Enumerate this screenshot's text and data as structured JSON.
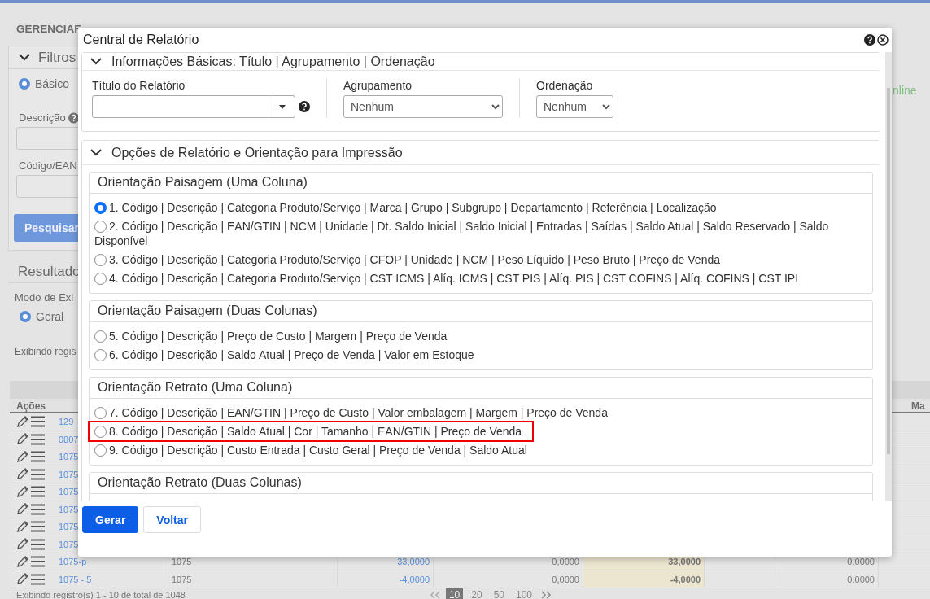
{
  "page": {
    "title": "GERENCIAF",
    "filters": {
      "title": "Filtros",
      "mode": {
        "label": "Básico",
        "selected": true
      },
      "fields": [
        {
          "label": "Descrição"
        },
        {
          "label": "Código/EAN"
        }
      ],
      "search_button": "Pesquisar",
      "status": "nline"
    },
    "results": {
      "title": "Resultado",
      "mode_label": "Modo de Exi",
      "mode": {
        "label": "Geral",
        "selected": true
      },
      "info": "Exibindo regis"
    },
    "table": {
      "columns": [
        "Ações",
        "Ma"
      ],
      "rows": [
        {
          "code": "129",
          "cells": []
        },
        {
          "code": "0807",
          "cells": []
        },
        {
          "code": "1075",
          "cells": []
        },
        {
          "code": "1075",
          "cells": []
        },
        {
          "code": "1075",
          "cells": []
        },
        {
          "code": "1075",
          "cells": []
        },
        {
          "code": "1075",
          "cells": []
        },
        {
          "code": "1075",
          "cells": []
        },
        {
          "code": "1075-p",
          "cells": [
            "1075",
            "33,0000",
            "0,0000",
            "33,0000",
            "0,0000"
          ]
        },
        {
          "code": "1075 - 5",
          "cells": [
            "1075",
            "-4,0000",
            "0,0000",
            "-4,0000",
            "0,0000"
          ]
        }
      ]
    },
    "footer": "Exibindo registro(s) 1 - 10 de total de 1048",
    "pages": [
      {
        "label": "10",
        "selected": true
      },
      {
        "label": "20",
        "selected": false
      },
      {
        "label": "50",
        "selected": false
      },
      {
        "label": "100",
        "selected": false
      }
    ]
  },
  "dialog": {
    "title": "Central de Relatório",
    "basic": {
      "title": "Informações Básicas: Título | Agrupamento | Ordenação",
      "expanded": true,
      "title_label": "Título do Relatório",
      "grouping": {
        "label": "Agrupamento",
        "value": "Nenhum"
      },
      "ordering": {
        "label": "Ordenação",
        "value": "Nenhum"
      }
    },
    "options": {
      "title": "Opções de Relatório e Orientação para Impressão",
      "expanded": true,
      "groups": [
        {
          "title": "Orientação Paisagem (Uma Coluna)",
          "items": [
            {
              "label": "1. Código | Descrição | Categoria Produto/Serviço | Marca | Grupo | Subgrupo | Departamento | Referência | Localização",
              "selected": true,
              "highlighted": false
            },
            {
              "label": "2. Código | Descrição | EAN/GTIN | NCM | Unidade | Dt. Saldo Inicial | Saldo Inicial | Entradas | Saídas | Saldo Atual | Saldo Reservado | Saldo Disponível",
              "selected": false,
              "highlighted": false
            },
            {
              "label": "3. Código | Descrição | Categoria Produto/Serviço | CFOP | Unidade | NCM | Peso Líquido | Peso Bruto | Preço de Venda",
              "selected": false,
              "highlighted": false
            },
            {
              "label": "4. Código | Descrição | Categoria Produto/Serviço | CST ICMS | Alíq. ICMS | CST PIS | Alíq. PIS | CST COFINS | Alíq. COFINS | CST IPI",
              "selected": false,
              "highlighted": false
            }
          ]
        },
        {
          "title": "Orientação Paisagem (Duas Colunas)",
          "items": [
            {
              "label": "5. Código | Descrição | Preço de Custo | Margem | Preço de Venda",
              "selected": false,
              "highlighted": false
            },
            {
              "label": "6. Código | Descrição | Saldo Atual | Preço de Venda | Valor em Estoque",
              "selected": false,
              "highlighted": false
            }
          ]
        },
        {
          "title": "Orientação Retrato (Uma Coluna)",
          "items": [
            {
              "label": "7. Código | Descrição | EAN/GTIN | Preço de Custo | Valor embalagem | Margem | Preço de Venda",
              "selected": false,
              "highlighted": false
            },
            {
              "label": "8. Código | Descrição | Saldo Atual | Cor | Tamanho | EAN/GTIN | Preço de Venda",
              "selected": false,
              "highlighted": true
            },
            {
              "label": "9. Código | Descrição | Custo Entrada | Custo Geral | Preço de Venda | Saldo Atual",
              "selected": false,
              "highlighted": false
            }
          ]
        },
        {
          "title": "Orientação Retrato (Duas Colunas)"
        }
      ]
    },
    "buttons": [
      {
        "label": "Gerar",
        "kind": "primary"
      },
      {
        "label": "Voltar",
        "kind": "secondary"
      }
    ]
  }
}
